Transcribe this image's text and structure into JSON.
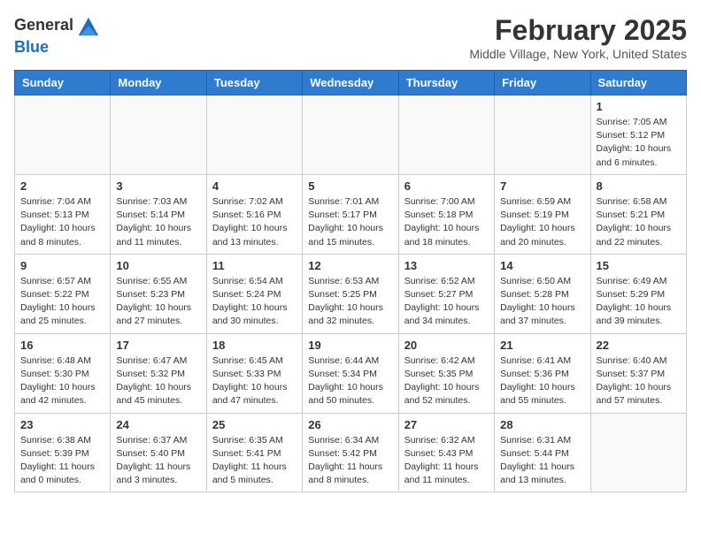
{
  "logo": {
    "general": "General",
    "blue": "Blue"
  },
  "header": {
    "month": "February 2025",
    "location": "Middle Village, New York, United States"
  },
  "weekdays": [
    "Sunday",
    "Monday",
    "Tuesday",
    "Wednesday",
    "Thursday",
    "Friday",
    "Saturday"
  ],
  "weeks": [
    [
      {
        "day": "",
        "info": ""
      },
      {
        "day": "",
        "info": ""
      },
      {
        "day": "",
        "info": ""
      },
      {
        "day": "",
        "info": ""
      },
      {
        "day": "",
        "info": ""
      },
      {
        "day": "",
        "info": ""
      },
      {
        "day": "1",
        "info": "Sunrise: 7:05 AM\nSunset: 5:12 PM\nDaylight: 10 hours and 6 minutes."
      }
    ],
    [
      {
        "day": "2",
        "info": "Sunrise: 7:04 AM\nSunset: 5:13 PM\nDaylight: 10 hours and 8 minutes."
      },
      {
        "day": "3",
        "info": "Sunrise: 7:03 AM\nSunset: 5:14 PM\nDaylight: 10 hours and 11 minutes."
      },
      {
        "day": "4",
        "info": "Sunrise: 7:02 AM\nSunset: 5:16 PM\nDaylight: 10 hours and 13 minutes."
      },
      {
        "day": "5",
        "info": "Sunrise: 7:01 AM\nSunset: 5:17 PM\nDaylight: 10 hours and 15 minutes."
      },
      {
        "day": "6",
        "info": "Sunrise: 7:00 AM\nSunset: 5:18 PM\nDaylight: 10 hours and 18 minutes."
      },
      {
        "day": "7",
        "info": "Sunrise: 6:59 AM\nSunset: 5:19 PM\nDaylight: 10 hours and 20 minutes."
      },
      {
        "day": "8",
        "info": "Sunrise: 6:58 AM\nSunset: 5:21 PM\nDaylight: 10 hours and 22 minutes."
      }
    ],
    [
      {
        "day": "9",
        "info": "Sunrise: 6:57 AM\nSunset: 5:22 PM\nDaylight: 10 hours and 25 minutes."
      },
      {
        "day": "10",
        "info": "Sunrise: 6:55 AM\nSunset: 5:23 PM\nDaylight: 10 hours and 27 minutes."
      },
      {
        "day": "11",
        "info": "Sunrise: 6:54 AM\nSunset: 5:24 PM\nDaylight: 10 hours and 30 minutes."
      },
      {
        "day": "12",
        "info": "Sunrise: 6:53 AM\nSunset: 5:25 PM\nDaylight: 10 hours and 32 minutes."
      },
      {
        "day": "13",
        "info": "Sunrise: 6:52 AM\nSunset: 5:27 PM\nDaylight: 10 hours and 34 minutes."
      },
      {
        "day": "14",
        "info": "Sunrise: 6:50 AM\nSunset: 5:28 PM\nDaylight: 10 hours and 37 minutes."
      },
      {
        "day": "15",
        "info": "Sunrise: 6:49 AM\nSunset: 5:29 PM\nDaylight: 10 hours and 39 minutes."
      }
    ],
    [
      {
        "day": "16",
        "info": "Sunrise: 6:48 AM\nSunset: 5:30 PM\nDaylight: 10 hours and 42 minutes."
      },
      {
        "day": "17",
        "info": "Sunrise: 6:47 AM\nSunset: 5:32 PM\nDaylight: 10 hours and 45 minutes."
      },
      {
        "day": "18",
        "info": "Sunrise: 6:45 AM\nSunset: 5:33 PM\nDaylight: 10 hours and 47 minutes."
      },
      {
        "day": "19",
        "info": "Sunrise: 6:44 AM\nSunset: 5:34 PM\nDaylight: 10 hours and 50 minutes."
      },
      {
        "day": "20",
        "info": "Sunrise: 6:42 AM\nSunset: 5:35 PM\nDaylight: 10 hours and 52 minutes."
      },
      {
        "day": "21",
        "info": "Sunrise: 6:41 AM\nSunset: 5:36 PM\nDaylight: 10 hours and 55 minutes."
      },
      {
        "day": "22",
        "info": "Sunrise: 6:40 AM\nSunset: 5:37 PM\nDaylight: 10 hours and 57 minutes."
      }
    ],
    [
      {
        "day": "23",
        "info": "Sunrise: 6:38 AM\nSunset: 5:39 PM\nDaylight: 11 hours and 0 minutes."
      },
      {
        "day": "24",
        "info": "Sunrise: 6:37 AM\nSunset: 5:40 PM\nDaylight: 11 hours and 3 minutes."
      },
      {
        "day": "25",
        "info": "Sunrise: 6:35 AM\nSunset: 5:41 PM\nDaylight: 11 hours and 5 minutes."
      },
      {
        "day": "26",
        "info": "Sunrise: 6:34 AM\nSunset: 5:42 PM\nDaylight: 11 hours and 8 minutes."
      },
      {
        "day": "27",
        "info": "Sunrise: 6:32 AM\nSunset: 5:43 PM\nDaylight: 11 hours and 11 minutes."
      },
      {
        "day": "28",
        "info": "Sunrise: 6:31 AM\nSunset: 5:44 PM\nDaylight: 11 hours and 13 minutes."
      },
      {
        "day": "",
        "info": ""
      }
    ]
  ]
}
